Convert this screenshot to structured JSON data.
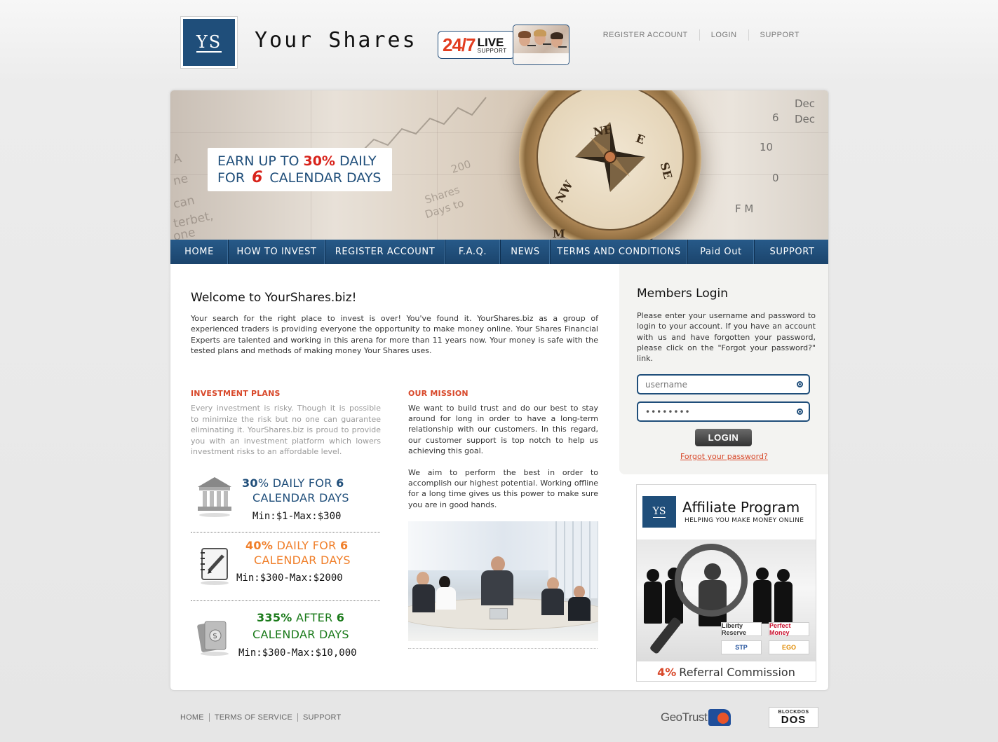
{
  "header": {
    "logo_text": "YS",
    "site_title": "Your Shares",
    "support_badge": {
      "big": "24/7",
      "live": "LIVE",
      "support": "SUPPORT"
    },
    "top_nav": [
      "REGISTER ACCOUNT",
      "LOGIN",
      "SUPPORT"
    ]
  },
  "banner": {
    "promo_line1_prefix": "EARN UP TO ",
    "promo_line1_highlight": "30%",
    "promo_line1_suffix": " DAILY",
    "promo_line2_prefix": "FOR",
    "promo_line2_highlight": "6",
    "promo_line2_suffix": "CALENDAR DAYS"
  },
  "menu": [
    "HOME",
    "HOW TO INVEST",
    "REGISTER ACCOUNT",
    "F.A.Q.",
    "NEWS",
    "TERMS AND CONDITIONS",
    "Paid Out",
    "SUPPORT"
  ],
  "welcome": {
    "title": "Welcome to YourShares.biz!",
    "text": "Your search for the right place to invest is over! You've found it. YourShares.biz as a group of experienced traders is providing everyone the opportunity to make money online. Your Shares Financial Experts are talented and working in this arena for more than 11 years now. Your money is safe with the tested plans and methods of making money Your Shares uses."
  },
  "investment_plans": {
    "title": "INVESTMENT PLANS",
    "text": "Every investment is risky. Though it is possible to minimize the risk but no one can guarantee eliminating it. YourShares.biz is proud to provide you with an investment platform which lowers investment risks to an affordable level.",
    "plans": [
      {
        "pct": "30",
        "pct_suffix": "% DAILY FOR",
        "days": "6",
        "line2": "CALENDAR DAYS",
        "minmax": "Min:$1-Max:$300",
        "color": "#1f4e7a",
        "icon": "bank-icon"
      },
      {
        "pct": "40%",
        "pct_suffix": " DAILY FOR",
        "days": "6",
        "line2": "CALENDAR DAYS",
        "minmax": "Min:$300-Max:$2000",
        "color": "#f07f2a",
        "icon": "notebook-icon"
      },
      {
        "pct": "335%",
        "pct_suffix": " AFTER",
        "days": "6",
        "line2": "CALENDAR DAYS",
        "minmax": "Min:$300-Max:$10,000",
        "color": "#2a8a2a",
        "icon": "money-icon"
      }
    ]
  },
  "mission": {
    "title": "OUR MISSION",
    "p1": "We want to build trust and do our best to stay around for long in order to have a long-term relationship with our customers. In this regard, our customer support is top notch to help us achieving this goal.",
    "p2": "We aim to perform the best in order to accomplish our highest potential. Working offline for a long time gives us this power to make sure you are in good hands."
  },
  "login": {
    "title": "Members Login",
    "text": "Please enter your username and password to login to your account. If you have an account with us and have forgotten your password, please click on the \"Forgot your password?\" link.",
    "username_placeholder": "username",
    "password_value": "••••••••",
    "button": "LOGIN",
    "forgot": "Forgot your password?"
  },
  "affiliate": {
    "logo": "YS",
    "title": "Affiliate Program",
    "subtitle": "HELPING YOU MAKE MONEY ONLINE",
    "commission_pct": "4%",
    "commission_text": "Referral Commission",
    "payment_logos": [
      "Liberty Reserve",
      "Perfect Money",
      "STP",
      "EGO"
    ]
  },
  "footer": {
    "links": [
      "HOME",
      "TERMS OF SERVICE",
      "SUPPORT"
    ],
    "geotrust": "GeoTrust",
    "blockdos_top": "BLOCKDOS",
    "blockdos_main": "DOS"
  },
  "colors": {
    "brand_blue": "#1f4e7a",
    "accent_orange": "#d8482a",
    "promo_red": "#d8231b"
  }
}
